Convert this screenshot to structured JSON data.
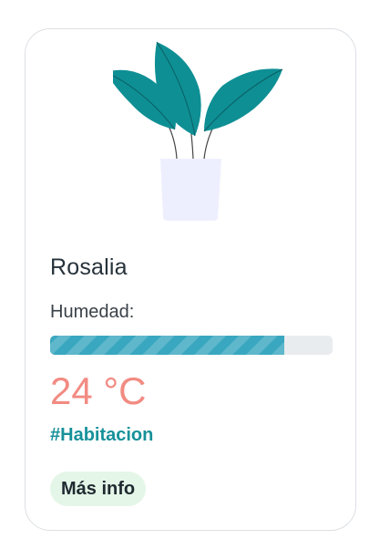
{
  "plant": {
    "name": "Rosalia",
    "humidity_label": "Humedad:",
    "humidity_level_percent": 83,
    "temperature": "24 °C",
    "tag": "#Habitacion",
    "more_button_label": "Más info",
    "image_icon": "potted-plant-icon"
  },
  "colors": {
    "progress_fill": "#3aa7c0",
    "temperature": "#f28b82",
    "tag": "#17919a",
    "button_bg": "#e4f6e8",
    "leaf": "#0e8f94",
    "pot": "#eeeffe"
  }
}
